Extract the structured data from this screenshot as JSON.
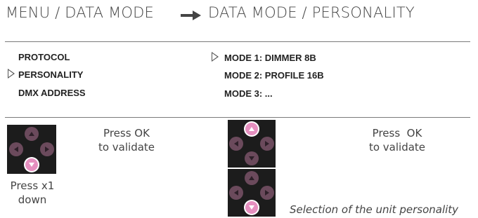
{
  "header": {
    "left": "MENU / DATA MODE",
    "right": "DATA MODE / PERSONALITY"
  },
  "menu": {
    "items": [
      "PROTOCOL",
      "PERSONALITY",
      "DMX ADDRESS"
    ]
  },
  "modes": {
    "items": [
      "MODE 1: DIMMER 8B",
      "MODE 2: PROFILE 16B",
      "MODE 3: ..."
    ]
  },
  "captions": {
    "press_ok_left": [
      "Press OK",
      "to validate"
    ],
    "press_ok_right": [
      "Press  OK",
      "to validate"
    ],
    "press_down": [
      "Press x1",
      "down"
    ],
    "selection": "Selection of the unit personality"
  },
  "icons": {
    "arrow": "right-arrow-icon",
    "selector": "triangle-pointer-icon",
    "keypad": "navigation-keypad-icon"
  },
  "colors": {
    "highlight_button": "#e58fbf",
    "button_body": "#8a5a74",
    "keypad_bg": "#1c1c1c"
  }
}
